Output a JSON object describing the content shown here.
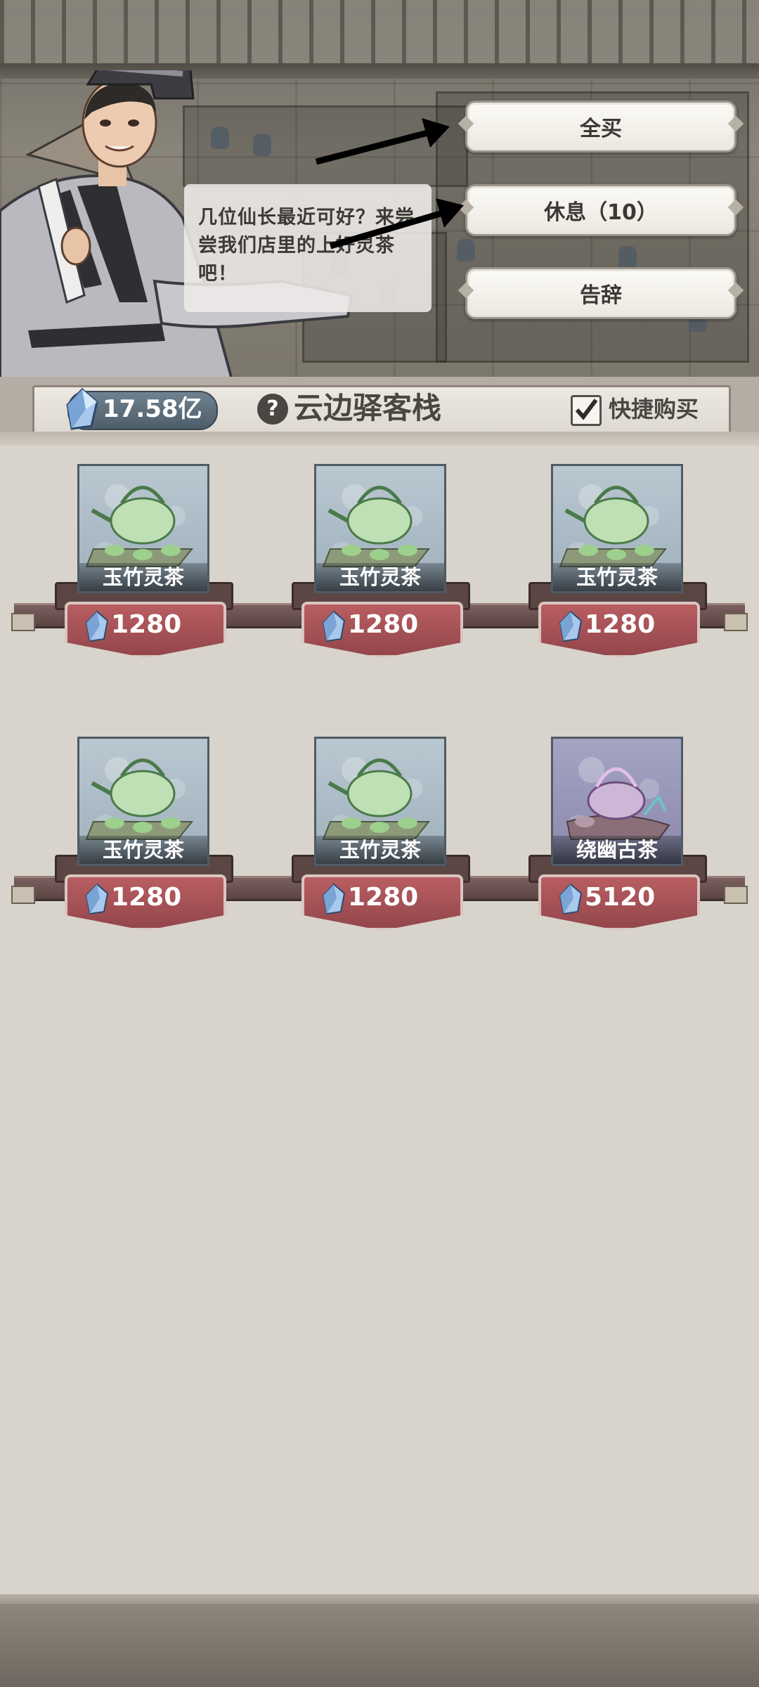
{
  "npc": {
    "dialogue": "几位仙长最近可好？来尝尝我们店里的上好灵茶吧！"
  },
  "menu": {
    "buy_all": "全买",
    "rest": "休息（10）",
    "leave": "告辞"
  },
  "header": {
    "currency": "17.58亿",
    "help": "?",
    "shop_name": "云边驿客栈",
    "quick_buy_label": "快捷购买",
    "quick_buy_checked": true
  },
  "items": [
    {
      "name": "玉竹灵茶",
      "price": "1280",
      "rarity": "green"
    },
    {
      "name": "玉竹灵茶",
      "price": "1280",
      "rarity": "green"
    },
    {
      "name": "玉竹灵茶",
      "price": "1280",
      "rarity": "green"
    },
    {
      "name": "玉竹灵茶",
      "price": "1280",
      "rarity": "green"
    },
    {
      "name": "玉竹灵茶",
      "price": "1280",
      "rarity": "green"
    },
    {
      "name": "绕幽古茶",
      "price": "5120",
      "rarity": "purple"
    }
  ],
  "colors": {
    "price_tag": "#a8545a",
    "menu_button": "#f4f1ea",
    "background": "#d8d4cc"
  }
}
